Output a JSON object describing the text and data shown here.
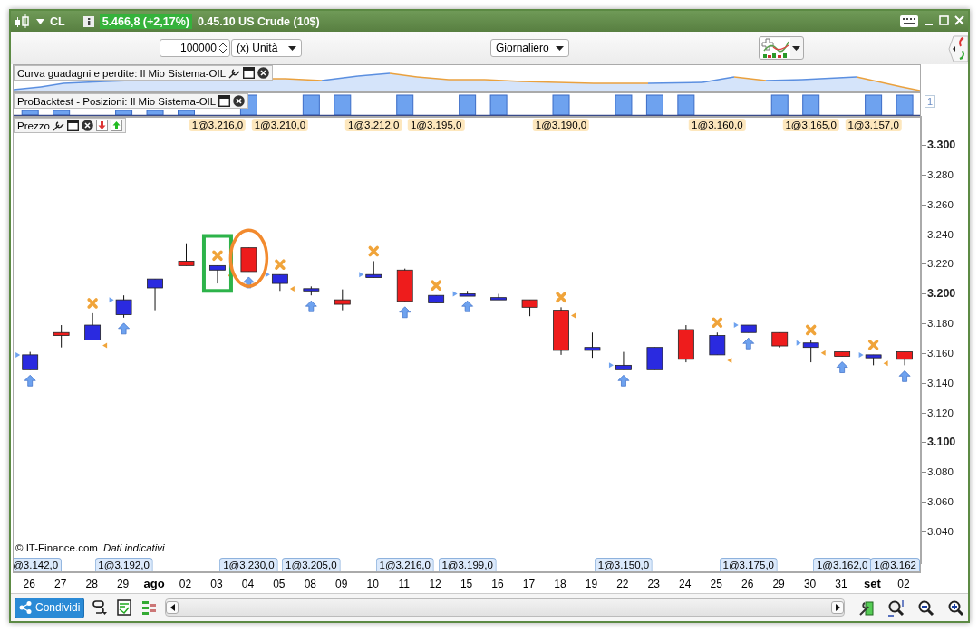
{
  "window": {
    "symbol": "CL",
    "change": "5.466,8 (+2,17%)",
    "title": "0.45.10 US Crude (10$)"
  },
  "toolbar": {
    "quantity": "100000",
    "unit": "(x) Unità",
    "period": "Giornaliero"
  },
  "equity_panel": {
    "label": "Curva guadagni e perdite: Il Mio Sistema-OIL"
  },
  "positions_panel": {
    "label": "ProBacktest - Posizioni: Il Mio Sistema-OIL",
    "scale": "1"
  },
  "price_panel": {
    "label": "Prezzo",
    "credit": "© IT-Finance.com",
    "disclaimer": "Dati indicativi",
    "y_ticks": [
      {
        "label": "3.300",
        "kind": "major"
      },
      {
        "label": "3.280",
        "kind": "minor"
      },
      {
        "label": "3.260",
        "kind": "minor"
      },
      {
        "label": "3.240",
        "kind": "minor"
      },
      {
        "label": "3.220",
        "kind": "minor"
      },
      {
        "label": "3.200",
        "kind": "major"
      },
      {
        "label": "3.180",
        "kind": "minor"
      },
      {
        "label": "3.160",
        "kind": "minor"
      },
      {
        "label": "3.140",
        "kind": "minor"
      },
      {
        "label": "3.120",
        "kind": "minor"
      },
      {
        "label": "3.100",
        "kind": "major"
      },
      {
        "label": "3.080",
        "kind": "minor"
      },
      {
        "label": "3.060",
        "kind": "minor"
      },
      {
        "label": "3.040",
        "kind": "minor"
      }
    ],
    "days": [
      {
        "label": "26",
        "kind": "day",
        "bottom_label": "@3.142,0"
      },
      {
        "label": "27",
        "kind": "day"
      },
      {
        "label": "28",
        "kind": "day"
      },
      {
        "label": "29",
        "kind": "day",
        "bottom_label": "1@3.192,0"
      },
      {
        "label": "ago",
        "kind": "month"
      },
      {
        "label": "02",
        "kind": "day"
      },
      {
        "label": "03",
        "kind": "day",
        "top_label": "1@3.216,0"
      },
      {
        "label": "04",
        "kind": "day",
        "bottom_label": "1@3.230,0"
      },
      {
        "label": "05",
        "kind": "day",
        "top_label": "1@3.210,0"
      },
      {
        "label": "08",
        "kind": "day",
        "bottom_label": "1@3.205,0"
      },
      {
        "label": "09",
        "kind": "day"
      },
      {
        "label": "10",
        "kind": "day",
        "top_label": "1@3.212,0"
      },
      {
        "label": "11",
        "kind": "day",
        "bottom_label": "1@3.216,0"
      },
      {
        "label": "12",
        "kind": "day",
        "top_label": "1@3.195,0"
      },
      {
        "label": "15",
        "kind": "day",
        "bottom_label": "1@3.199,0"
      },
      {
        "label": "16",
        "kind": "day"
      },
      {
        "label": "17",
        "kind": "day"
      },
      {
        "label": "18",
        "kind": "day",
        "top_label": "1@3.190,0"
      },
      {
        "label": "19",
        "kind": "day"
      },
      {
        "label": "22",
        "kind": "day",
        "bottom_label": "1@3.150,0"
      },
      {
        "label": "23",
        "kind": "day"
      },
      {
        "label": "24",
        "kind": "day"
      },
      {
        "label": "25",
        "kind": "day",
        "top_label": "1@3.160,0"
      },
      {
        "label": "26",
        "kind": "day",
        "bottom_label": "1@3.175,0"
      },
      {
        "label": "29",
        "kind": "day"
      },
      {
        "label": "30",
        "kind": "day",
        "top_label": "1@3.165,0"
      },
      {
        "label": "31",
        "kind": "day",
        "bottom_label": "1@3.162,0"
      },
      {
        "label": "set",
        "kind": "month",
        "top_label": "1@3.157,0"
      },
      {
        "label": "02",
        "kind": "day",
        "bottom_label": "1@3.162"
      }
    ]
  },
  "bottom_bar": {
    "share_button": "Condividi"
  }
}
